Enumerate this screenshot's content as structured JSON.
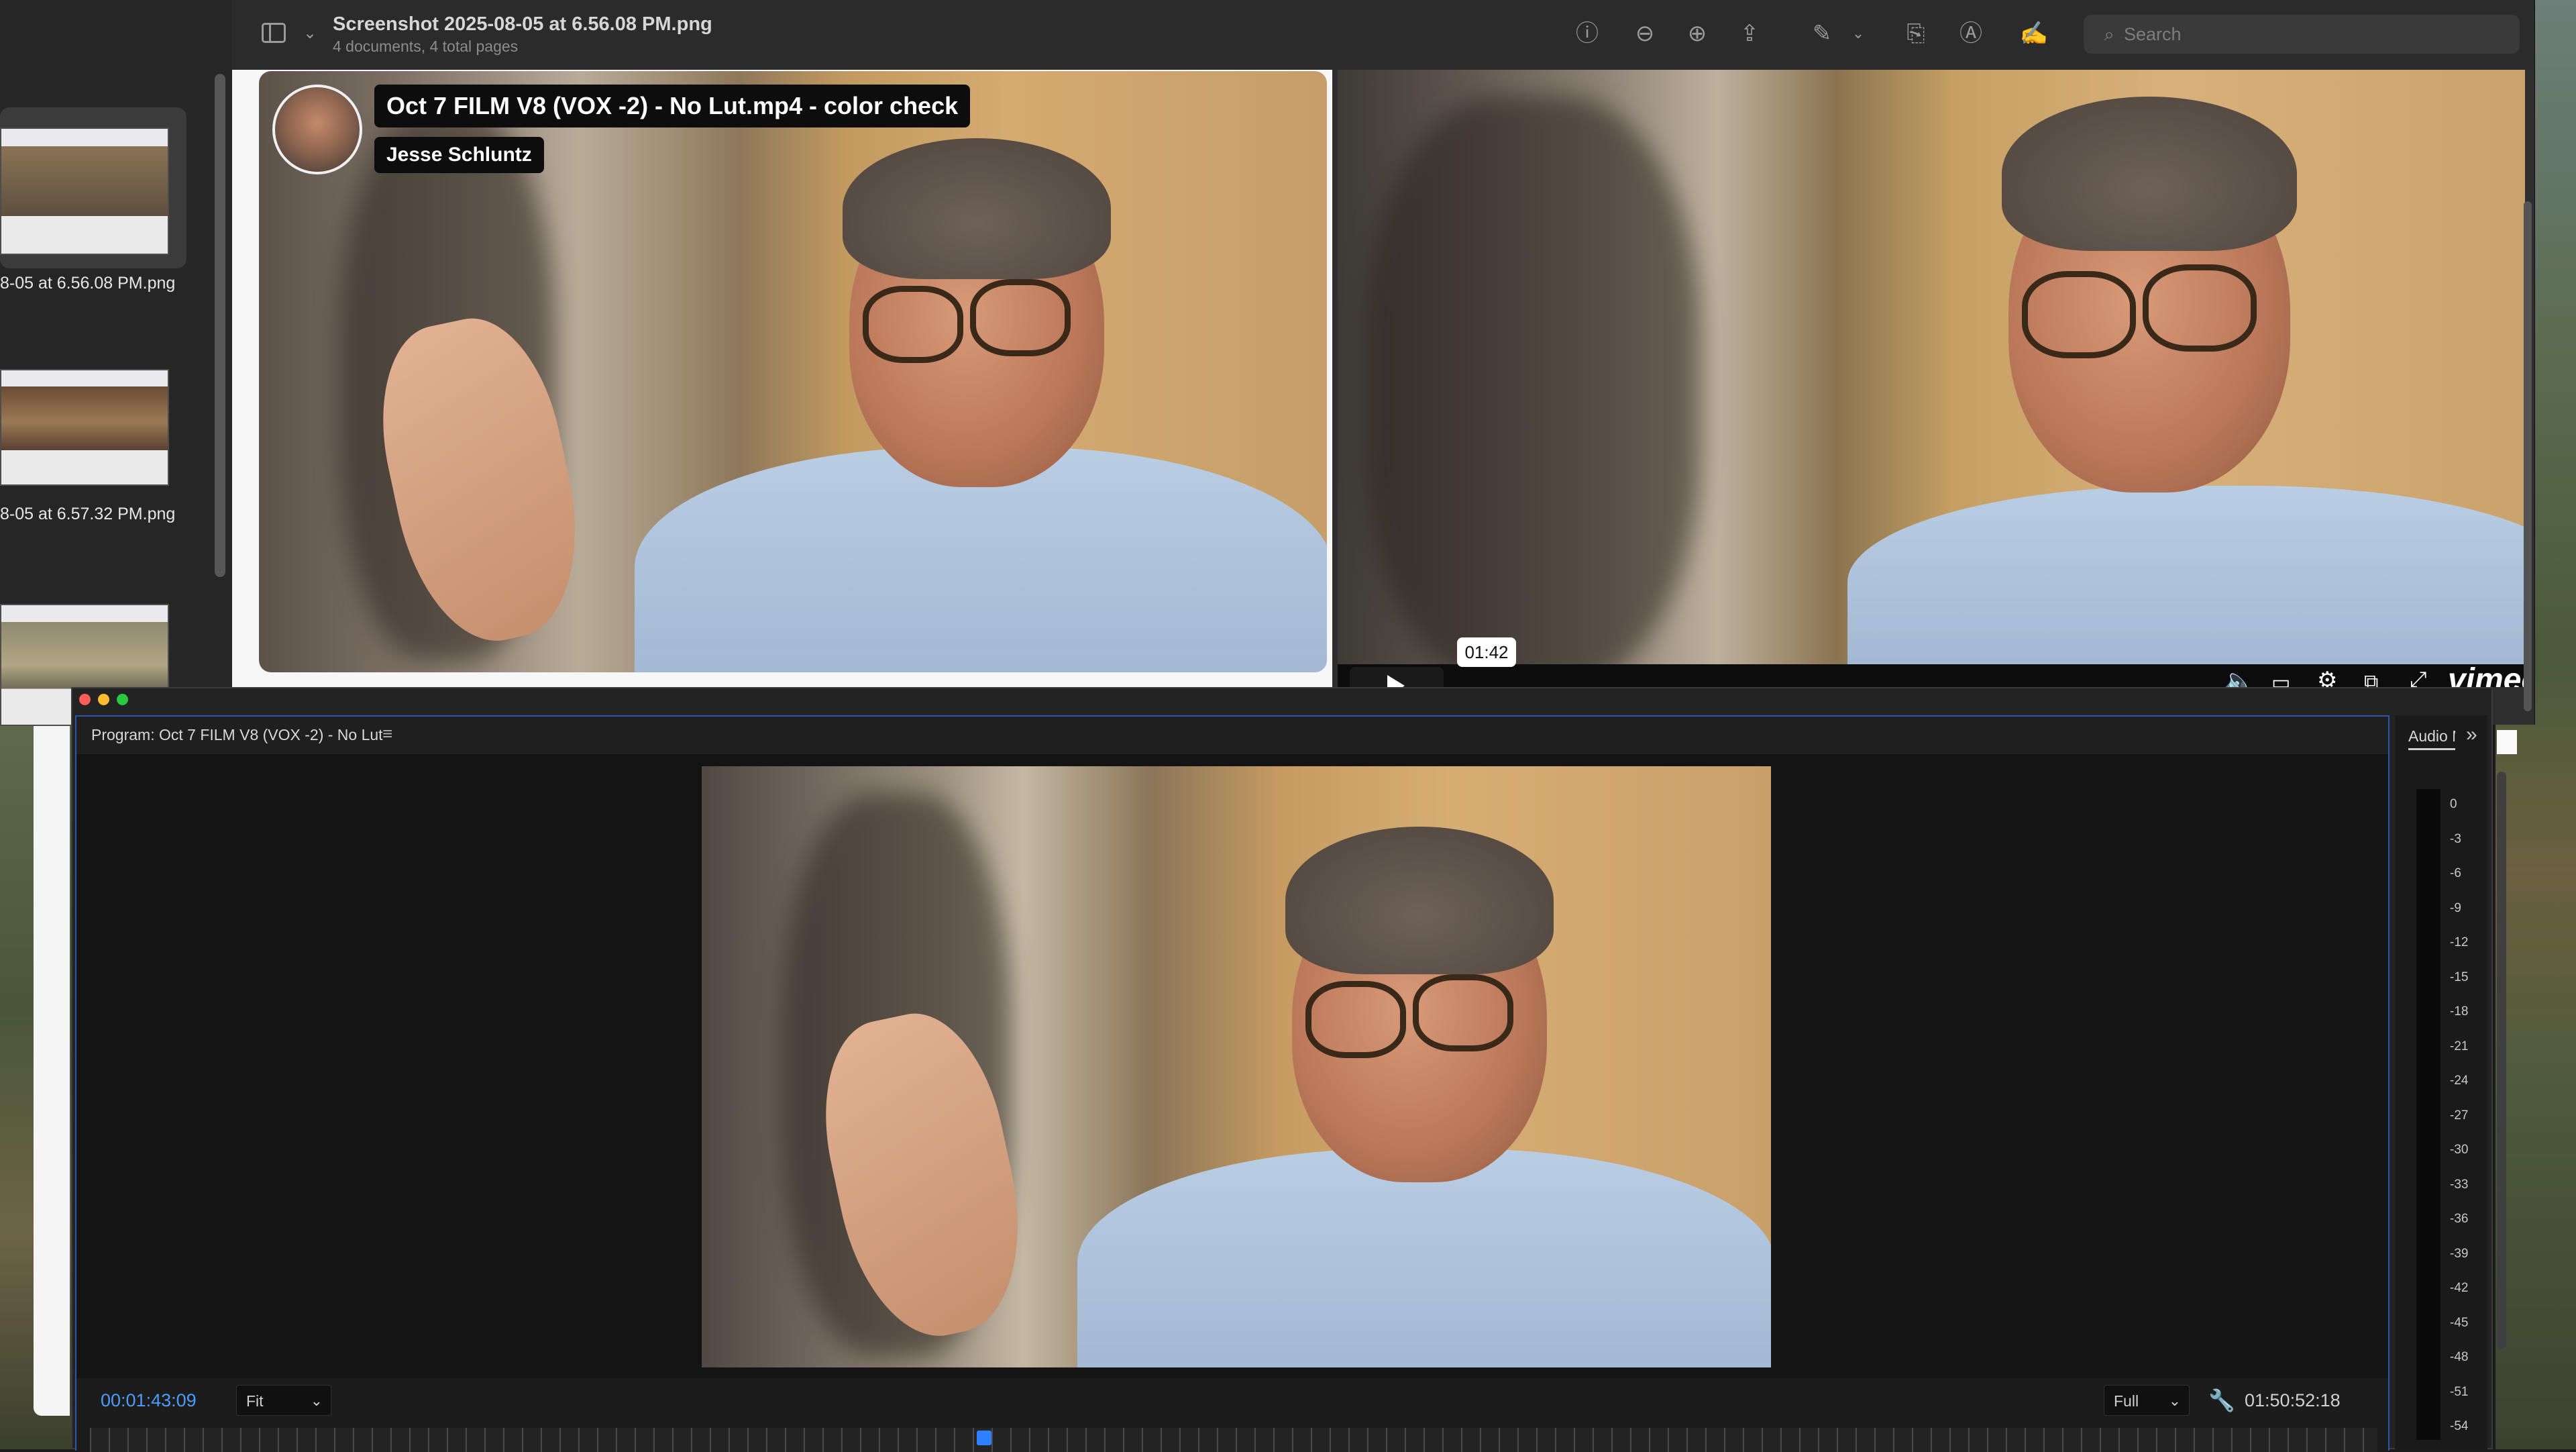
{
  "preview": {
    "window_title": "Screenshot 2025-08-05 at 6.56.08 PM.png",
    "window_subtitle": "4 documents, 4 total pages",
    "search_placeholder": "Search",
    "thumbnails": [
      {
        "label": "8-05 at 6.56.08 PM.png",
        "selected": true
      },
      {
        "label": "8-05 at 6.57.32 PM.png",
        "selected": false
      },
      {
        "label": "",
        "selected": false
      }
    ],
    "toolbar_icons": [
      "info-icon",
      "zoom-out-icon",
      "zoom-in-icon",
      "share-icon",
      "markup-pen-icon",
      "chevron-down-icon",
      "rotate-icon",
      "annotate-icon",
      "sign-icon"
    ]
  },
  "video": {
    "title": "Oct 7 FILM V8 (VOX -2) - No Lut.mp4 - color check",
    "author": "Jesse Schluntz",
    "hover_time": "01:42",
    "brand": "vimeo"
  },
  "premiere": {
    "panel_title": "Program: Oct 7 FILM V8 (VOX -2) - No Lut",
    "timecode_current": "00:01:43:09",
    "zoom_select": "Fit",
    "resolution_select": "Full",
    "timecode_duration": "01:50:52:18",
    "audio_panel_tab": "Audio Meters",
    "meter_ticks": [
      "0",
      "-3",
      "-6",
      "-9",
      "-12",
      "-15",
      "-18",
      "-21",
      "-24",
      "-27",
      "-30",
      "-33",
      "-36",
      "-39",
      "-42",
      "-45",
      "-48",
      "-51",
      "-54"
    ]
  },
  "colors": {
    "accent_blue": "#2f80ff",
    "timecode_blue": "#4a9cff",
    "panel_border": "#2e56a8"
  }
}
